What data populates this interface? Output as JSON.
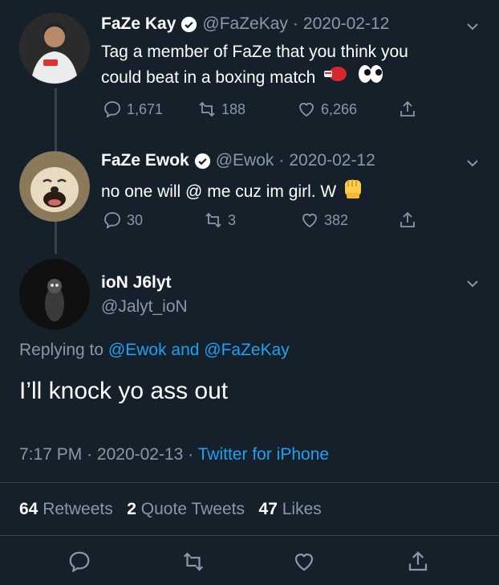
{
  "tweet1": {
    "name": "FaZe Kay",
    "handle": "@FaZeKay",
    "date": "2020-02-12",
    "sep": "·",
    "text_line1": "Tag a member of FaZe that you think you",
    "text_line2": "could beat in a boxing match",
    "replies": "1,671",
    "retweets": "188",
    "likes": "6,266"
  },
  "tweet2": {
    "name": "FaZe Ewok",
    "handle": "@Ewok",
    "date": "2020-02-12",
    "sep": "·",
    "text": "no one will @ me cuz im girl. W",
    "replies": "30",
    "retweets": "3",
    "likes": "382"
  },
  "main": {
    "name": "ioN J6lyt",
    "handle": "@Jalyt_ioN",
    "replying_prefix": "Replying to",
    "replying_to": "@Ewok and @FaZeKay",
    "text": "I’ll knock yo ass out",
    "time": "7:17 PM",
    "date": "2020-02-13",
    "sep1": "·",
    "sep2": "·",
    "client": "Twitter for iPhone",
    "retweet_count": "64",
    "retweet_label": "Retweets",
    "quote_count": "2",
    "quote_label": "Quote Tweets",
    "like_count": "47",
    "like_label": "Likes"
  },
  "colors": {
    "background": "#15202b",
    "link": "#1da1f2",
    "muted": "#8899a6",
    "divider": "#38444d"
  }
}
